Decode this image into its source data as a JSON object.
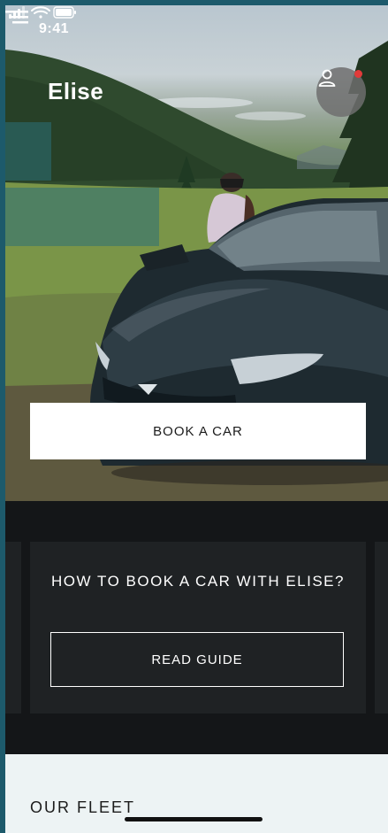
{
  "status_bar": {
    "time": "9:41"
  },
  "brand": {
    "name": "Elise"
  },
  "hero": {
    "book_button_label": "BOOK A CAR"
  },
  "guide_card": {
    "title": "HOW TO BOOK A CAR WITH ELISE?",
    "button_label": "READ GUIDE"
  },
  "fleet": {
    "title": "OUR FLEET"
  },
  "icons": {
    "signal": "signal-icon",
    "wifi": "wifi-icon",
    "battery": "battery-icon",
    "profile": "user-icon",
    "notification": "notification-dot"
  },
  "colors": {
    "accent_teal": "#286e78",
    "notification_red": "#e23a3a",
    "dark_bg": "#141618",
    "card_bg": "#1f2224",
    "fleet_bg": "#edf3f4"
  }
}
